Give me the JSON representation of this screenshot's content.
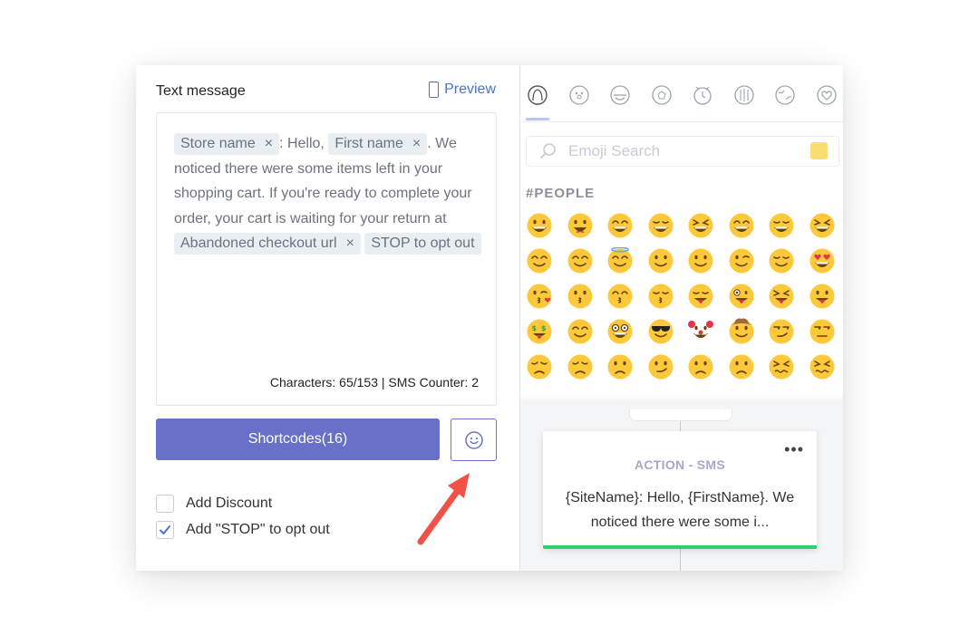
{
  "left": {
    "title": "Text message",
    "preview_label": "Preview",
    "message": {
      "tag_store": "Store name",
      "text1": ": Hello,",
      "tag_first": "First name",
      "text2": ". We noticed there were some items left in your shopping cart. If you're ready to complete your order, your cart is waiting for your return at",
      "tag_checkout": "Abandoned checkout url",
      "tag_stop": "STOP to opt out",
      "remove_glyph": "×"
    },
    "counter": "Characters: 65/153 | SMS Counter: 2",
    "shortcodes_label": "Shortcodes(16)",
    "options": [
      {
        "label": "Add Discount",
        "checked": false
      },
      {
        "label": "Add \"STOP\" to opt out",
        "checked": true
      }
    ]
  },
  "emoji_picker": {
    "categories": [
      "people-icon",
      "nature-icon",
      "food-icon",
      "activity-icon",
      "travel-icon",
      "objects-icon",
      "places-icon",
      "symbols-icon"
    ],
    "search_placeholder": "Emoji Search",
    "section_label": "#PEOPLE",
    "emojis": [
      "grinning",
      "smiley",
      "smile",
      "grin",
      "laughing",
      "sweat-smile",
      "joy",
      "rofl",
      "blush",
      "relaxed",
      "innocent",
      "slight-smile",
      "upside-down",
      "wink",
      "relieved",
      "heart-eyes",
      "kissing-heart",
      "kissing",
      "kissing-smiling",
      "kissing-closed",
      "yum",
      "crazy",
      "squint-tongue",
      "tongue",
      "money-mouth",
      "hugging",
      "nerd",
      "sunglasses",
      "clown",
      "cowboy",
      "smirk",
      "unamused",
      "disappointed",
      "pensive",
      "worried",
      "confused",
      "slight-frown",
      "frowning",
      "persevere",
      "confounded"
    ],
    "colors": {
      "face": "#fdc93a",
      "feature": "#664500",
      "heart": "#e0364c"
    }
  },
  "action_card": {
    "title": "ACTION - SMS",
    "text": "{SiteName}: Hello, {FirstName}. We noticed there were some i...",
    "menu_glyph": "•••",
    "accent": "#2fcf6e"
  }
}
